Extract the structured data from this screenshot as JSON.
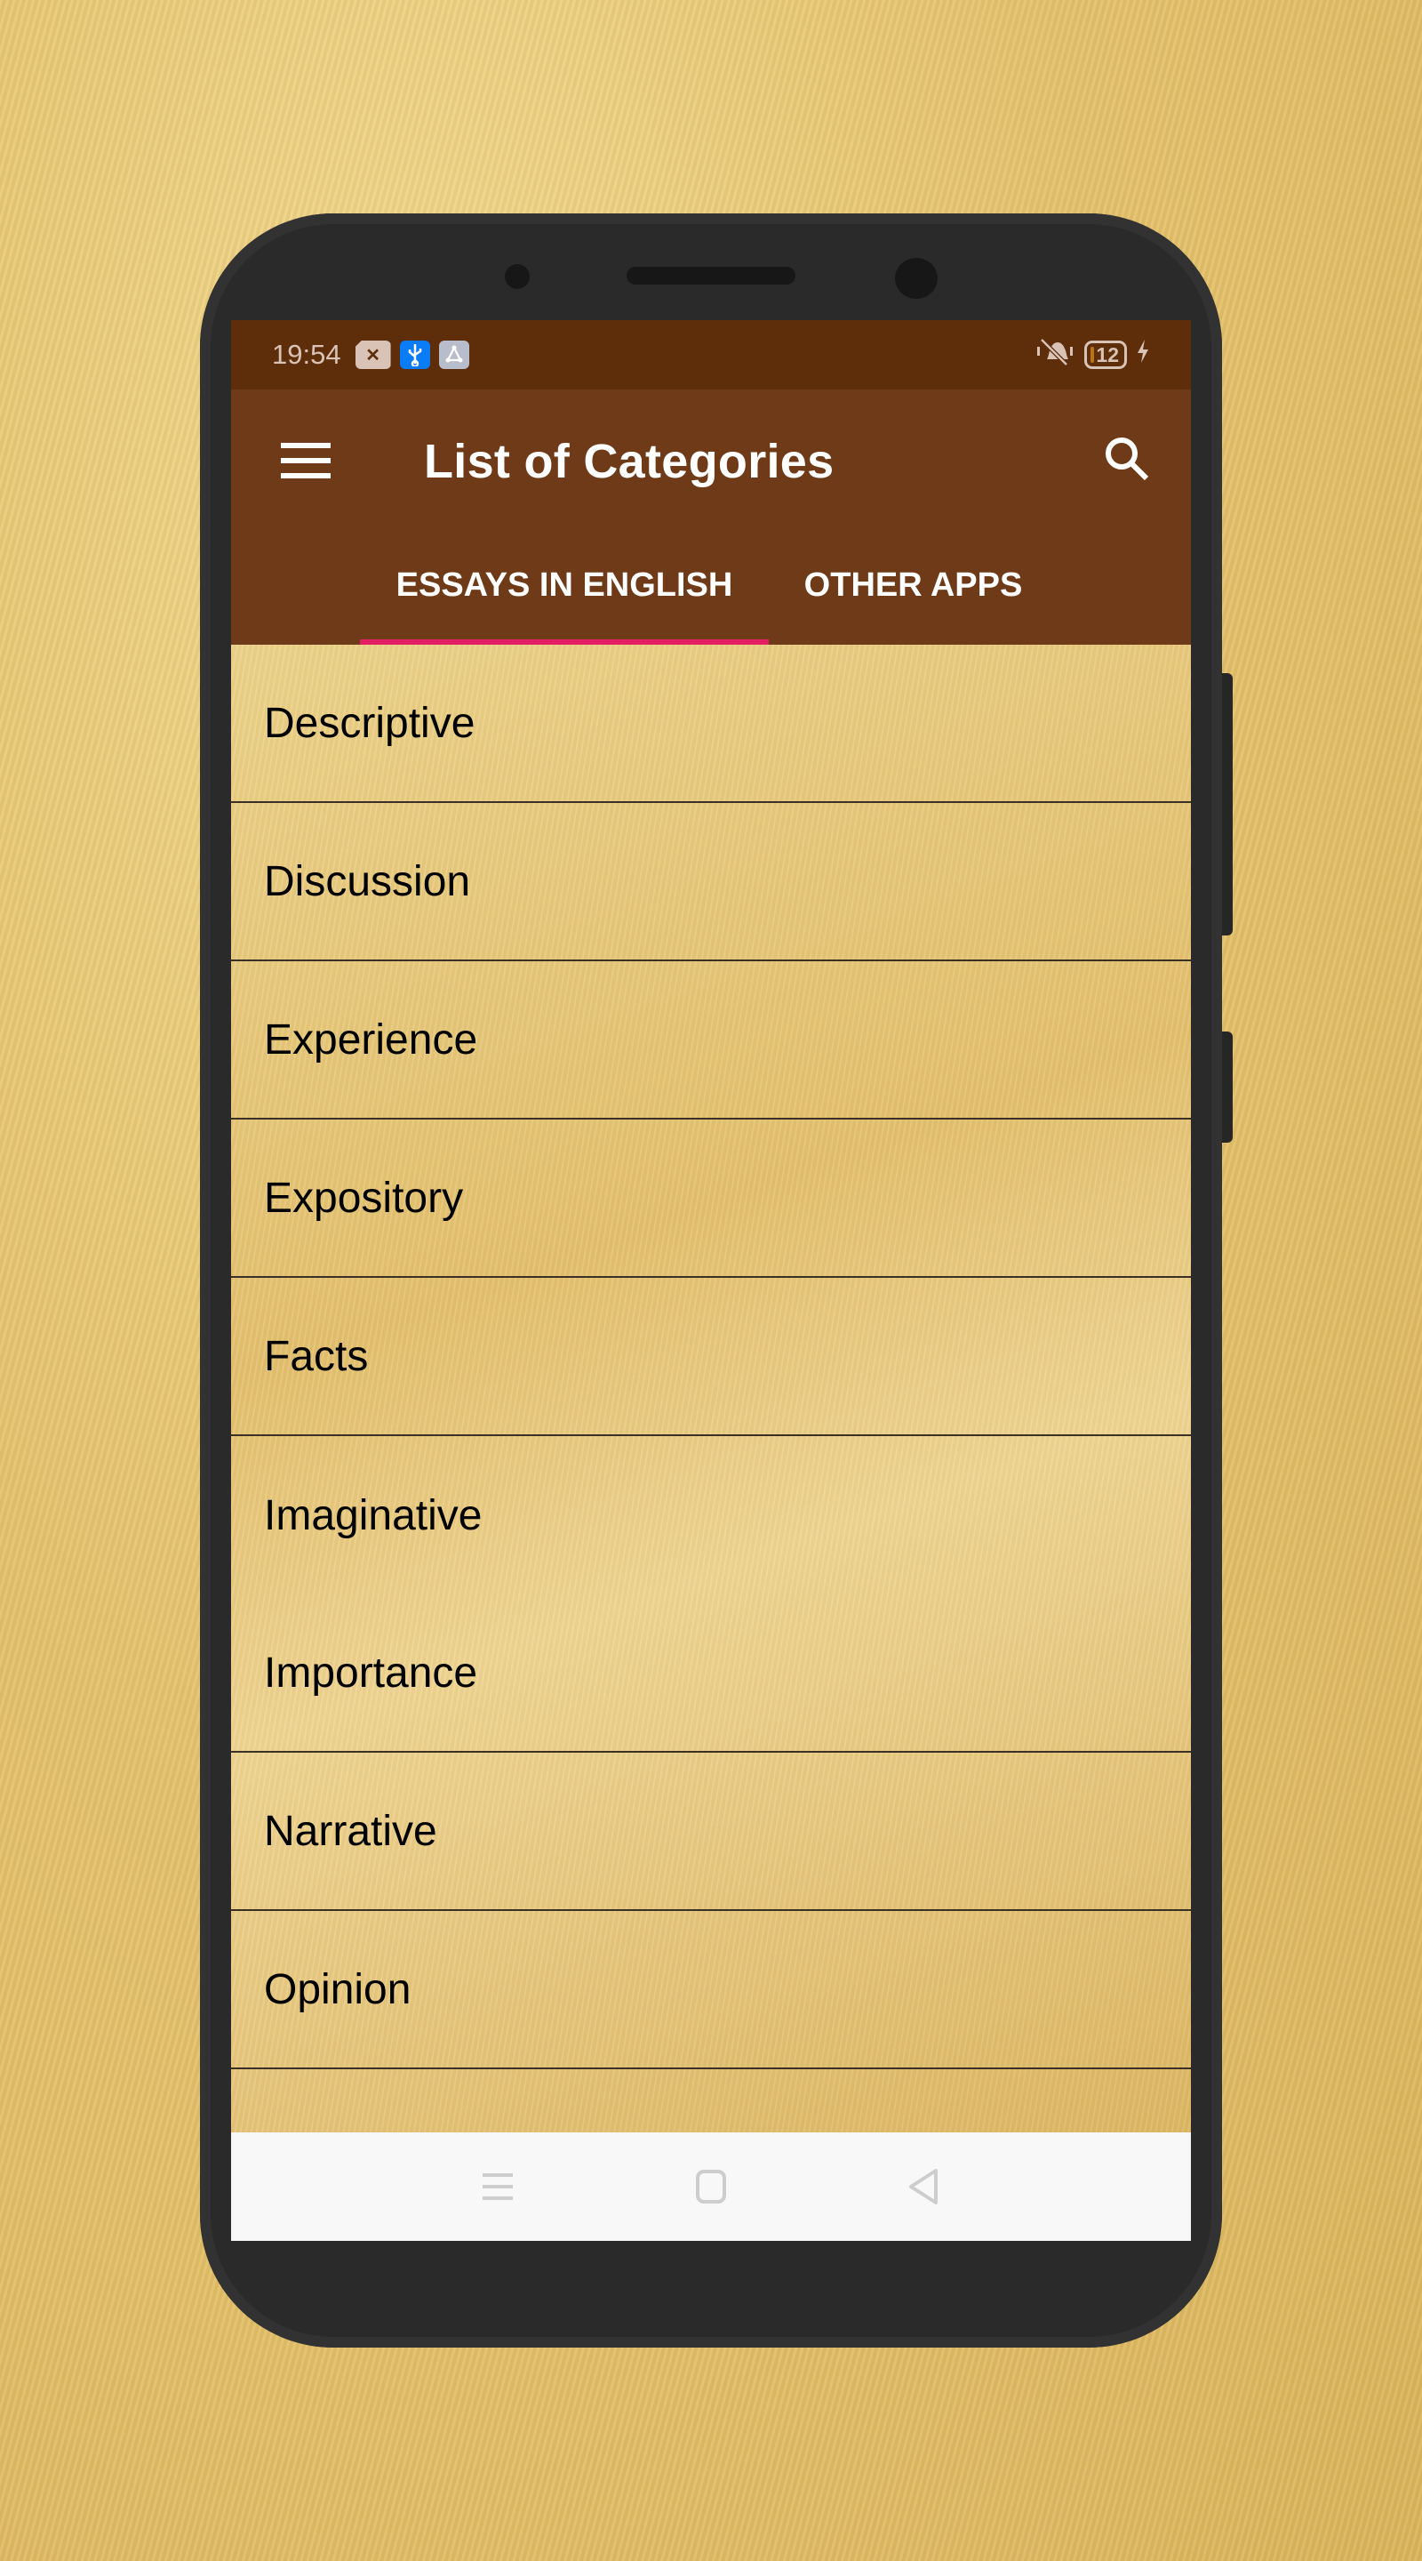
{
  "status_bar": {
    "time": "19:54",
    "notification_icons": [
      "close-notification-icon",
      "usb-icon",
      "network-share-icon"
    ],
    "right_icons": [
      "vibrate-mute-icon",
      "battery-icon",
      "charging-icon"
    ],
    "battery_level": "12",
    "colors": {
      "usb_badge": "#0a7cf5",
      "share_badge": "#b7bdca",
      "close_badge": "#d9c2b6"
    }
  },
  "app_bar": {
    "title": "List of Categories",
    "menu_icon": "hamburger-menu-icon",
    "search_icon": "search-icon",
    "background": "#6e3a18"
  },
  "tabs": [
    {
      "label": "ESSAYS IN ENGLISH",
      "active": true
    },
    {
      "label": "OTHER APPS",
      "active": false
    }
  ],
  "tab_indicator_color": "#e31e63",
  "categories": [
    "Descriptive",
    "Discussion",
    "Experience",
    "Expository",
    "Facts",
    "Imaginative",
    "Importance",
    "Narrative",
    "Opinion",
    ""
  ],
  "nav_bar": {
    "buttons": [
      "recents-icon",
      "home-icon",
      "back-icon"
    ]
  }
}
